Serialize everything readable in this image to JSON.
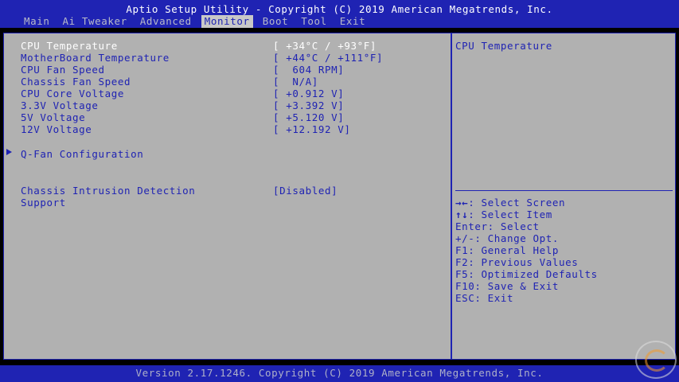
{
  "header": {
    "title": "Aptio Setup Utility - Copyright (C) 2019 American Megatrends, Inc.",
    "tabs": [
      {
        "label": "Main"
      },
      {
        "label": "Ai Tweaker"
      },
      {
        "label": "Advanced"
      },
      {
        "label": "Monitor"
      },
      {
        "label": "Boot"
      },
      {
        "label": "Tool"
      },
      {
        "label": "Exit"
      }
    ],
    "active_tab": "Monitor"
  },
  "monitor": {
    "items": [
      {
        "label": "CPU Temperature",
        "value": "[ +34°C / +93°F]"
      },
      {
        "label": "MotherBoard Temperature",
        "value": "[ +44°C / +111°F]"
      },
      {
        "label": "CPU Fan Speed",
        "value": "[  604 RPM]"
      },
      {
        "label": "Chassis Fan Speed",
        "value": "[  N/A]"
      },
      {
        "label": "CPU Core Voltage",
        "value": "[ +0.912 V]"
      },
      {
        "label": "3.3V Voltage",
        "value": "[ +3.392 V]"
      },
      {
        "label": "5V Voltage",
        "value": "[ +5.120 V]"
      },
      {
        "label": "12V Voltage",
        "value": "[ +12.192 V]"
      }
    ],
    "submenu": "Q-Fan Configuration",
    "intrusion": {
      "label_line1": "Chassis Intrusion Detection",
      "label_line2": "Support",
      "value": "[Disabled]"
    }
  },
  "help": {
    "description": "CPU Temperature",
    "keys": [
      {
        "key": "→←",
        "desc": ": Select Screen"
      },
      {
        "key": "↑↓",
        "desc": ": Select Item"
      },
      {
        "key": "",
        "desc": "Enter: Select"
      },
      {
        "key": "",
        "desc": "+/-: Change Opt."
      },
      {
        "key": "",
        "desc": "F1: General Help"
      },
      {
        "key": "",
        "desc": "F2: Previous Values"
      },
      {
        "key": "",
        "desc": "F5: Optimized Defaults"
      },
      {
        "key": "",
        "desc": "F10: Save & Exit"
      },
      {
        "key": "",
        "desc": "ESC: Exit"
      }
    ]
  },
  "footer": {
    "text": "Version 2.17.1246. Copyright (C) 2019 American Megatrends, Inc."
  },
  "colors": {
    "accent": "#1f23b3",
    "background": "#b1b1b1",
    "highlight_text": "#ffffff"
  }
}
